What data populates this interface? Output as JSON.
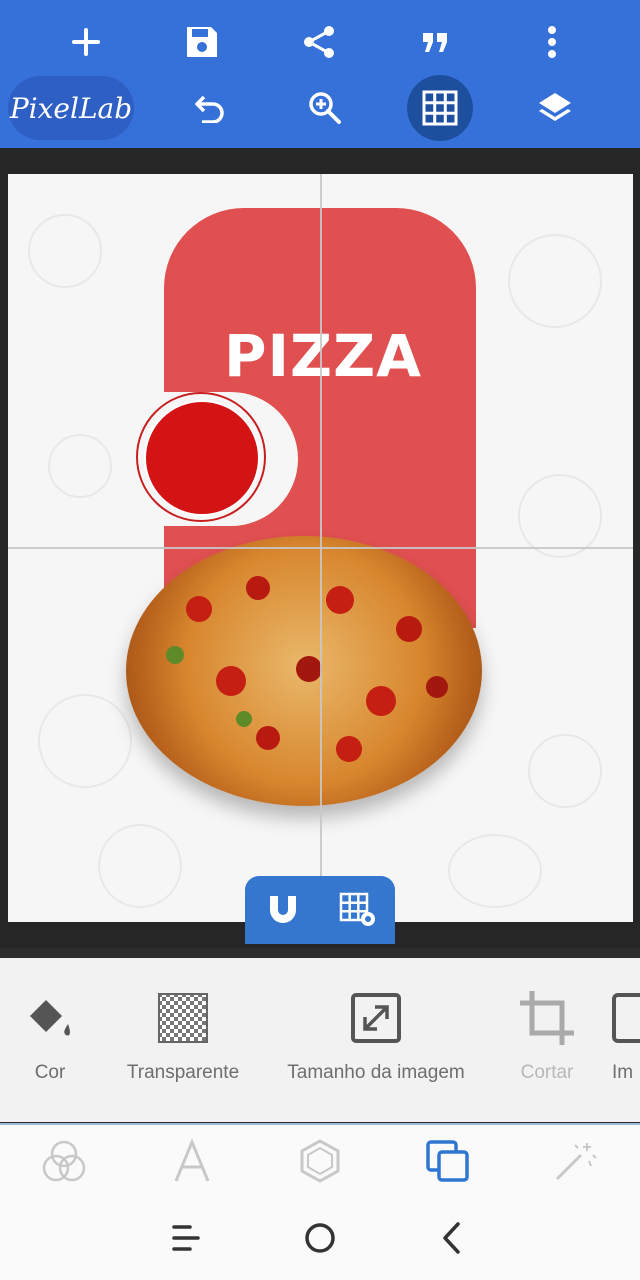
{
  "app": {
    "logo_text": "PixelLab"
  },
  "top_toolbar": {
    "row1": [
      "add-icon",
      "save-icon",
      "share-icon",
      "quote-icon",
      "more-vertical-icon"
    ],
    "row2": [
      "undo-icon",
      "zoom-in-icon",
      "grid-icon",
      "layers-icon"
    ],
    "active": "grid-icon"
  },
  "canvas": {
    "title_text": "PIZZA",
    "accent_color": "#e05050"
  },
  "snap_bar": [
    "magnet-icon",
    "grid-settings-icon"
  ],
  "tools": [
    {
      "label": "Cor",
      "icon": "paint-bucket-icon"
    },
    {
      "label": "Transparente",
      "icon": "checkerboard-icon"
    },
    {
      "label": "Tamanho da imagem",
      "icon": "resize-icon"
    },
    {
      "label": "Cortar",
      "icon": "crop-icon"
    },
    {
      "label": "Im",
      "icon": "image-icon"
    }
  ],
  "bottom_tabs": {
    "items": [
      "blend-circles-icon",
      "text-a-icon",
      "hexagon-icon",
      "layers-square-icon",
      "magic-wand-icon"
    ],
    "active": "layers-square-icon",
    "active_color": "#2f76d2"
  },
  "system_nav": [
    "menu-icon",
    "home-icon",
    "back-icon"
  ]
}
